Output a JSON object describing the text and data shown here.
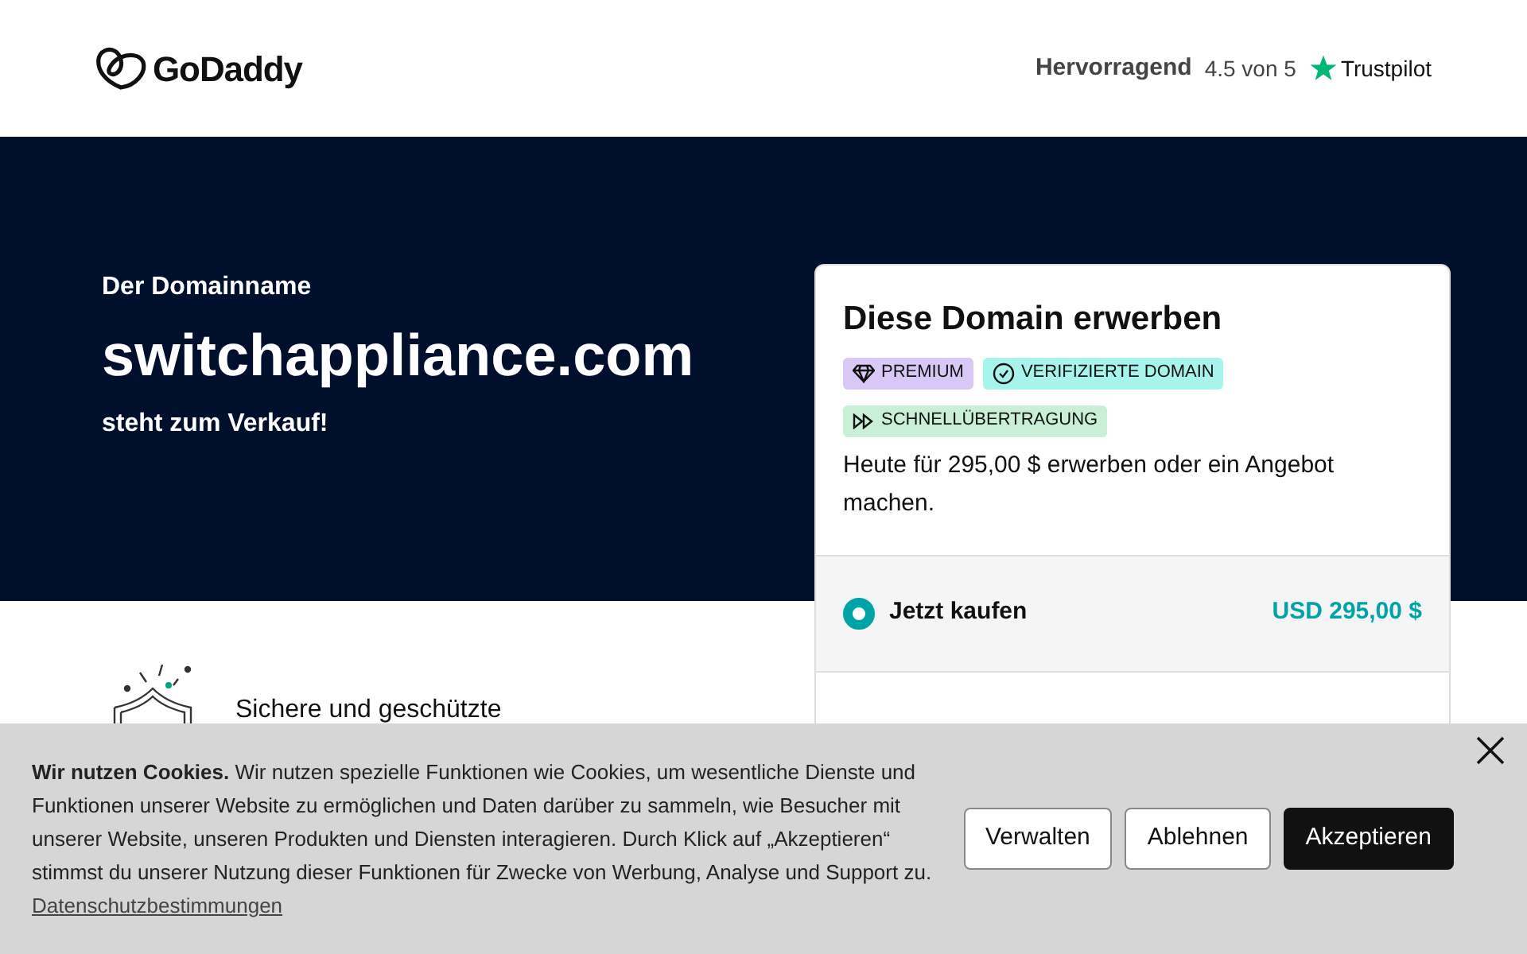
{
  "header": {
    "logo": "GoDaddy",
    "rating_label": "Hervorragend",
    "rating_score": "4.5 von 5",
    "rating_brand": "Trustpilot"
  },
  "hero": {
    "eyebrow": "Der Domainname",
    "domain": "switchappliance.com",
    "subtitle": "steht zum Verkauf!"
  },
  "feature": {
    "text": "Sichere und geschützte"
  },
  "card": {
    "title": "Diese Domain erwerben",
    "badges": [
      {
        "kind": "premium",
        "label": "PREMIUM",
        "color": "#d9c8f5"
      },
      {
        "kind": "verified",
        "label": "VERIFIZIERTE DOMAIN",
        "color": "#a6f4ec"
      },
      {
        "kind": "fast",
        "label": "SCHNELLÜBERTRAGUNG",
        "color": "#c9f0d6"
      }
    ],
    "description": "Heute für 295,00 $ erwerben oder ein Angebot machen.",
    "options": [
      {
        "label": "Jetzt kaufen",
        "price": "USD 295,00 $",
        "selected": true
      }
    ]
  },
  "cookie_banner": {
    "text": "**Wir nutzen Cookies.** Wir nutzen spezielle Funktionen wie Cookies, um wesentliche Dienste und Funktionen unserer Website zu ermöglichen und Daten darüber zu sammeln, wie Besucher mit unserer Website, unseren Produkten und Diensten interagieren. Durch Klick auf „Akzeptieren“ stimmst du unserer Nutzung dieser Funktionen für Zwecke von Werbung, Analyse und Support zu.",
    "link": "Datenschutzbestimmungen",
    "buttons": [
      {
        "kind": "outline",
        "label": "Verwalten"
      },
      {
        "kind": "outline",
        "label": "Ablehnen"
      },
      {
        "kind": "primary",
        "label": "Akzeptieren"
      }
    ]
  }
}
